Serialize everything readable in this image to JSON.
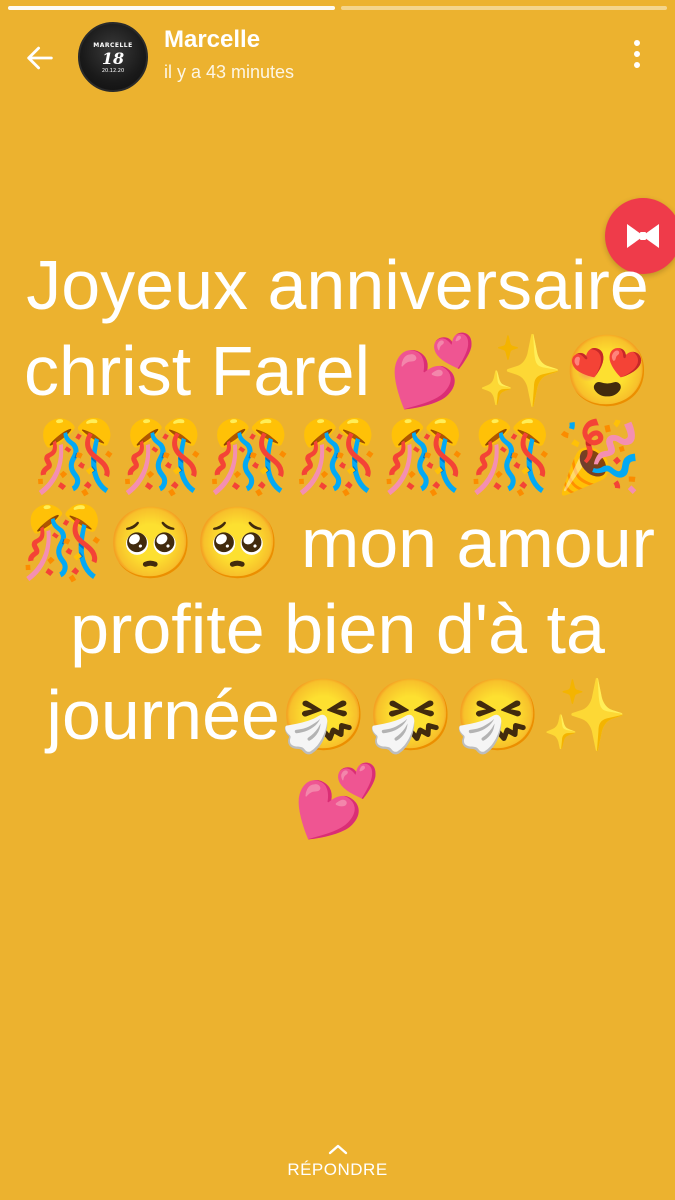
{
  "story": {
    "progress_done": 0.5
  },
  "header": {
    "user_name": "Marcelle",
    "timestamp": "il y a 43 minutes",
    "avatar": {
      "jersey_name": "MARCELLE",
      "jersey_number": "18",
      "jersey_date": "20.12.20"
    }
  },
  "status": {
    "text": "Joyeux anniversaire christ Farel 💕✨😍🎊🎊🎊🎊🎊🎊🎉🎊🥺🥺 mon amour profite bien d'à ta journée🤧🤧🤧✨💕",
    "background_color": "#ecb22f"
  },
  "reply": {
    "label": "RÉPONDRE"
  },
  "icons": {
    "back": "arrow-left-icon",
    "menu": "more-vertical-icon",
    "reply_chevron": "chevron-up-icon",
    "badge": "bowtie-icon"
  }
}
